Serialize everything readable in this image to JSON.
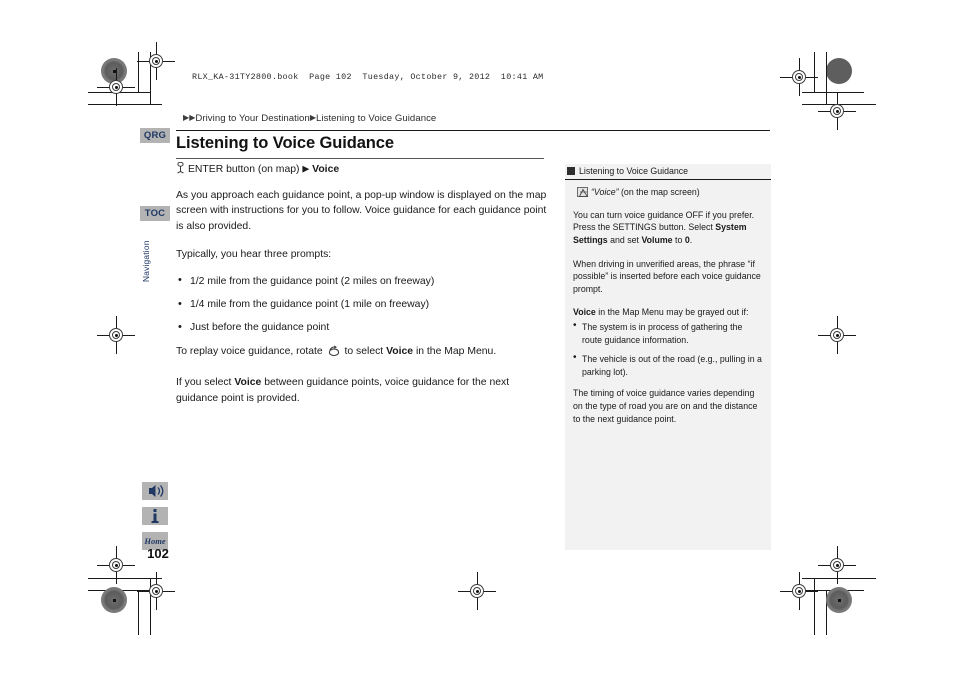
{
  "print_header": {
    "text": "RLX_KA-31TY2800.book  Page 102  Tuesday, October 9, 2012  10:41 AM"
  },
  "breadcrumb": {
    "arrow": "▶",
    "level1": "Driving to Your Destination",
    "level2": "Listening to Voice Guidance"
  },
  "page_title": "Listening to Voice Guidance",
  "tabs": [
    {
      "label": "QRG",
      "name": "qrg"
    },
    {
      "label": "TOC",
      "name": "toc"
    }
  ],
  "section_tab_label": "Navigation",
  "footer_icons": [
    {
      "name": "voice-guidance-icon",
      "label": ""
    },
    {
      "name": "info-icon",
      "label": ""
    },
    {
      "name": "home-icon",
      "label": "Home"
    }
  ],
  "page_number": "102",
  "main": {
    "command_prefix": "ENTER button (on map)",
    "command_arrow": "▶",
    "command_target": "Voice",
    "intro": "As you approach each guidance point, a pop-up window is displayed on the map screen with instructions for you to follow. Voice guidance for each guidance point is also provided.",
    "prompts_lead": "Typically, you hear three prompts:",
    "prompts": [
      "1/2 mile from the guidance point (2 miles on freeway)",
      "1/4 mile from the guidance point (1 mile on freeway)",
      "Just before the guidance point"
    ],
    "replay_pre": "To replay voice guidance, rotate",
    "replay_mid": "to select",
    "replay_bold": "Voice",
    "replay_post": "in the Map Menu.",
    "between_pre": "If you select",
    "between_bold": "Voice",
    "between_post": "between guidance points, voice guidance for the next guidance point is provided."
  },
  "side_panel": {
    "heading": "Listening to Voice Guidance",
    "quote_italic": "“Voice”",
    "quote_rest": "(on the map screen)",
    "p1_a": "You can turn voice guidance OFF if you prefer. Press the SETTINGS button. Select ",
    "p1_b1": "System Settings",
    "p1_c": " and set ",
    "p1_b2": "Volume",
    "p1_d": " to ",
    "p1_b3": "0",
    "p1_e": ".",
    "p2": "When driving in unverified areas, the phrase “if possible” is inserted before each voice guidance prompt.",
    "p3_b": "Voice",
    "p3_rest": " in the Map Menu may be grayed out if:",
    "grayed_reasons": [
      "The system is in process of gathering the route guidance information.",
      "The vehicle is out of the road (e.g., pulling in a parking lot)."
    ],
    "p4": "The timing of voice guidance varies depending on the type of road you are on and the distance to the next guidance point."
  },
  "colors": {
    "tab_bg": "#b3b3b3",
    "tab_text": "#1f3864",
    "panel_bg": "#f2f2f2",
    "rule": "#1a1a1a"
  }
}
